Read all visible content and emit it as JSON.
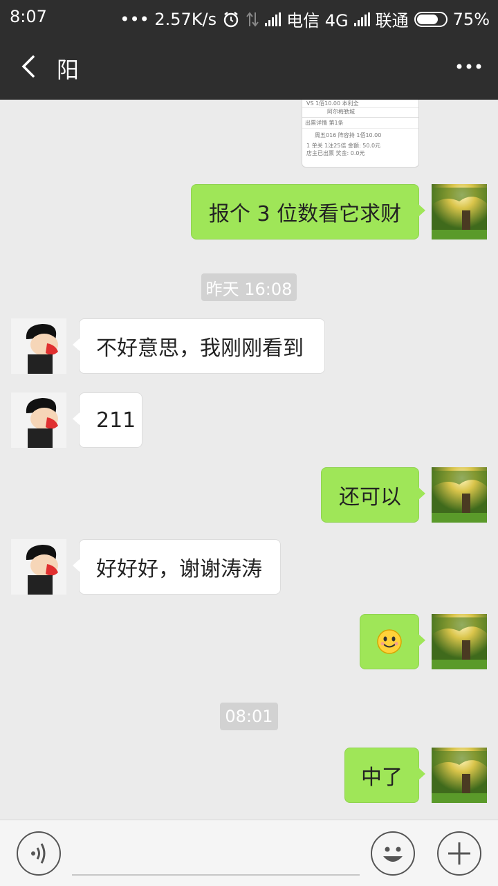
{
  "status_bar": {
    "time": "8:07",
    "net_speed": "••• 2.57K/s",
    "carrier1": "电信 4G",
    "carrier2": "联通",
    "battery": "75%"
  },
  "header": {
    "title": "阳"
  },
  "screenshot_card": {
    "line1": "VS   1佰10.00    本利全",
    "line2": "阿尔梅勒城",
    "line3": "出票详情                                    第1条",
    "line4": "周五016  阵容持                 1佰10.00",
    "line5": "1   单关 1注25倍              金额: 50.0元",
    "line6": "    店主已出票                    奖金: 0.0元"
  },
  "messages": [
    {
      "side": "me",
      "text": "报个 3 位数看它求财"
    },
    {
      "type": "time",
      "text": "昨天 16:08"
    },
    {
      "side": "them",
      "text": "不好意思，我刚刚看到"
    },
    {
      "side": "them",
      "text": "211"
    },
    {
      "side": "me",
      "text": "还可以"
    },
    {
      "side": "them",
      "text": "好好好，谢谢涛涛"
    },
    {
      "side": "me",
      "text": "😊",
      "emoji": "smile-emoji"
    },
    {
      "type": "time",
      "text": "08:01"
    },
    {
      "side": "me",
      "text": "中了"
    }
  ],
  "colors": {
    "nav_bg": "#2e2e2e",
    "chat_bg": "#ebebeb",
    "my_bubble": "#9fe658",
    "their_bubble": "#ffffff",
    "timestamp_bg": "#d2d2d2"
  },
  "input_bar": {
    "voice_icon": "voice-icon",
    "emoji_icon": "emoji-icon",
    "plus_icon": "plus-icon"
  }
}
